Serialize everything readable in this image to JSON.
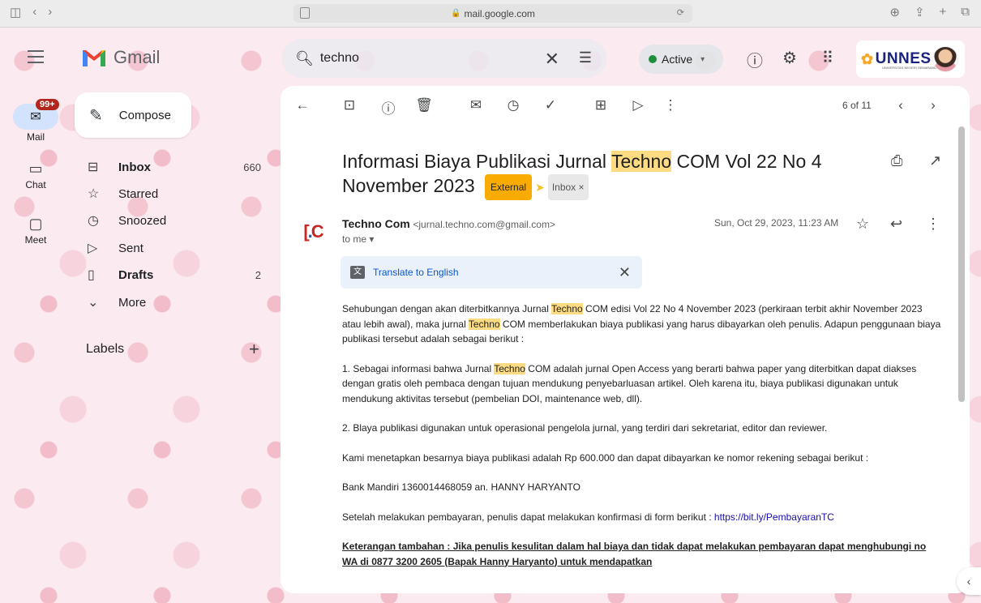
{
  "browser": {
    "url": "mail.google.com"
  },
  "header": {
    "app_name": "Gmail",
    "search_query": "techno",
    "status_label": "Active",
    "org_logo_text": "UNNES",
    "org_logo_subtext": "UNIVERSITAS NEGERI SEMARANG"
  },
  "rail": {
    "items": [
      {
        "label": "Mail",
        "badge": "99+"
      },
      {
        "label": "Chat"
      },
      {
        "label": "Meet"
      }
    ]
  },
  "nav": {
    "compose_label": "Compose",
    "items": [
      {
        "label": "Inbox",
        "count": "660",
        "bold": true,
        "icon": "inbox-icon"
      },
      {
        "label": "Starred",
        "count": "",
        "bold": false,
        "icon": "star-icon"
      },
      {
        "label": "Snoozed",
        "count": "",
        "bold": false,
        "icon": "clock-icon"
      },
      {
        "label": "Sent",
        "count": "",
        "bold": false,
        "icon": "send-icon"
      },
      {
        "label": "Drafts",
        "count": "2",
        "bold": true,
        "icon": "draft-icon"
      },
      {
        "label": "More",
        "count": "",
        "bold": false,
        "icon": "chevron-down-icon"
      }
    ],
    "labels_heading": "Labels"
  },
  "toolbar": {
    "pager": "6 of 11"
  },
  "email": {
    "subject_before": "Informasi Biaya Publikasi Jurnal ",
    "subject_highlight": "Techno",
    "subject_after": " COM Vol 22 No 4 November 2023",
    "tag_external": "External",
    "tag_inbox": "Inbox ×",
    "sender_name": "Techno Com",
    "sender_email": "<jurnal.techno.com@gmail.com>",
    "to_line": "to me ▾",
    "date": "Sun, Oct 29, 2023, 11:23 AM",
    "translate_label": "Translate to English",
    "highlight_word": "Techno",
    "p1_a": "Sehubungan dengan akan diterbitkannya Jurnal ",
    "p1_b": " COM edisi Vol 22 No 4 November 2023 (perkiraan terbit akhir November 2023 atau lebih awal), maka jurnal ",
    "p1_c": " COM memberlakukan biaya publikasi yang harus dibayarkan oleh penulis. Adapun penggunaan biaya publikasi tersebut adalah sebagai berikut :",
    "p2_a": "1. Sebagai informasi bahwa Jurnal ",
    "p2_b": " COM adalah jurnal Open Access yang berarti bahwa paper yang diterbitkan dapat diakses dengan gratis oleh pembaca dengan tujuan mendukung penyebarluasan artikel. Oleh karena itu, biaya publikasi digunakan untuk mendukung aktivitas tersebut (pembelian DOI, maintenance web, dll).",
    "p3": "2. Blaya publikasi digunakan untuk operasional pengelola jurnal, yang terdiri dari sekretariat, editor dan reviewer.",
    "p4": "Kami menetapkan besarnya biaya publikasi adalah Rp 600.000 dan dapat dibayarkan ke nomor rekening sebagai berikut :",
    "p5": "Bank Mandiri 1360014468059 an. HANNY HARYANTO",
    "p6": "Setelah melakukan pembayaran, penulis dapat melakukan konfirmasi di form berikut : ",
    "p6_link": "https://bit.ly/PembayaranTC",
    "p7": "Keterangan tambahan : Jika penulis kesulitan dalam hal biaya dan tidak dapat melakukan pembayaran dapat menghubungi no WA di 0877 3200 2605 (Bapak Hanny Haryanto) untuk mendapatkan"
  },
  "colors": {
    "highlight": "#fddb82",
    "external_tag": "#f9ab00",
    "mail_pill": "#d3e3fd",
    "badge": "#b3261e",
    "active_dot": "#1e8e3e"
  }
}
